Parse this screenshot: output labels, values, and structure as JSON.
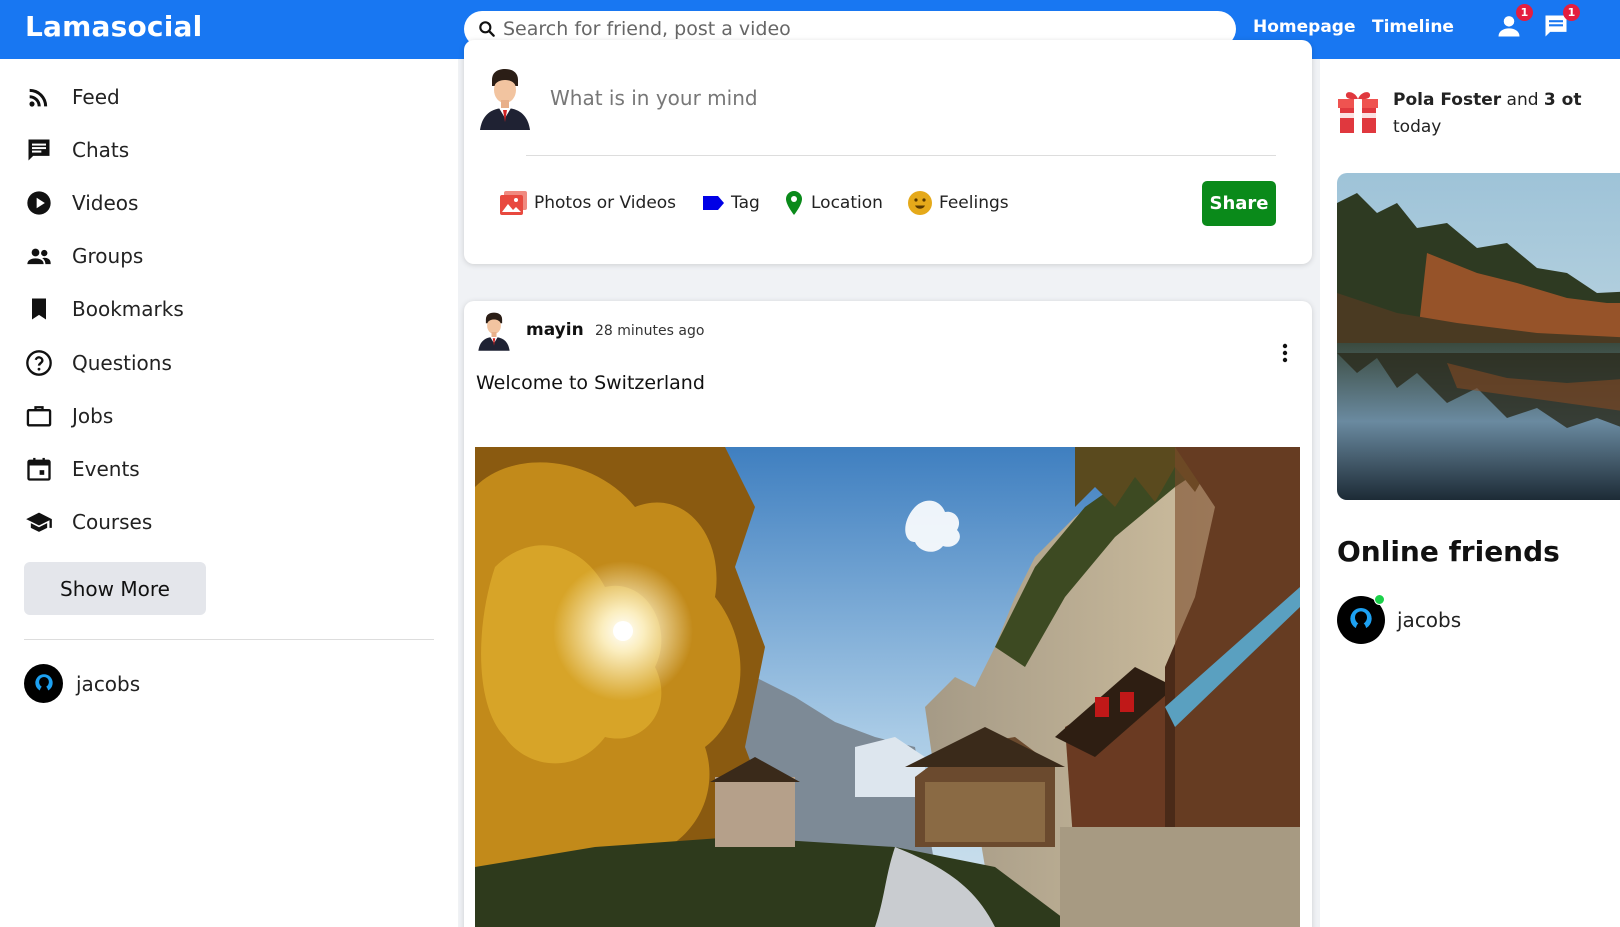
{
  "app": {
    "logo": "Lamasocial"
  },
  "topbar": {
    "search_placeholder": "Search for friend, post a video",
    "links": [
      "Homepage",
      "Timeline"
    ],
    "person_badge": "1",
    "chat_badge": "1",
    "color": "#1877f2"
  },
  "sidebar": {
    "items": [
      {
        "label": "Feed",
        "icon": "rss-feed-icon"
      },
      {
        "label": "Chats",
        "icon": "chat-icon"
      },
      {
        "label": "Videos",
        "icon": "play-circle-icon"
      },
      {
        "label": "Groups",
        "icon": "group-icon"
      },
      {
        "label": "Bookmarks",
        "icon": "bookmark-icon"
      },
      {
        "label": "Questions",
        "icon": "help-circle-icon"
      },
      {
        "label": "Jobs",
        "icon": "briefcase-icon"
      },
      {
        "label": "Events",
        "icon": "calendar-icon"
      },
      {
        "label": "Courses",
        "icon": "school-icon"
      }
    ],
    "show_more": "Show More",
    "friends": [
      {
        "name": "jacobs"
      }
    ]
  },
  "share": {
    "placeholder": "What is in your mind",
    "options": [
      {
        "label": "Photos or Videos",
        "icon": "photo-icon",
        "color": "#e8493f"
      },
      {
        "label": "Tag",
        "icon": "label-icon",
        "color": "#0000e6"
      },
      {
        "label": "Location",
        "icon": "location-pin-icon",
        "color": "#0a8a1a"
      },
      {
        "label": "Feelings",
        "icon": "emoji-icon",
        "color": "#e5a91a"
      }
    ],
    "share_button": "Share",
    "share_color": "#0a8a1a"
  },
  "post": {
    "username": "mayin",
    "time": "28 minutes ago",
    "text": "Welcome to Switzerland"
  },
  "rightbar": {
    "birthday": {
      "name": "Pola Foster",
      "connector": "and",
      "others": "3 ot",
      "suffix": "today"
    },
    "online_title": "Online friends",
    "online_friends": [
      {
        "name": "jacobs"
      }
    ]
  }
}
